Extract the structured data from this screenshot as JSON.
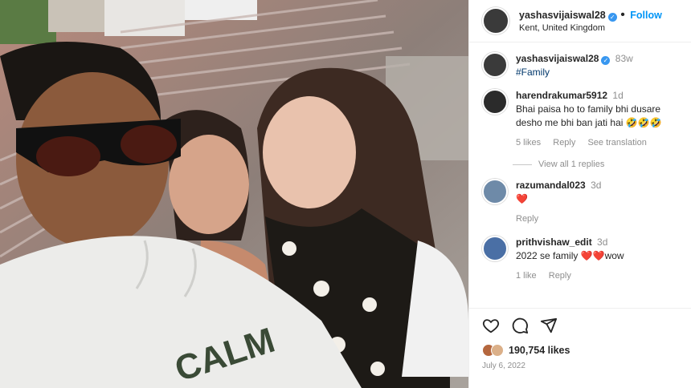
{
  "post": {
    "username": "yashasvijaiswal28",
    "follow_label": "Follow",
    "location": "Kent, United Kingdom",
    "caption_age": "83w",
    "caption": "#Family",
    "likes": "190,754 likes",
    "date": "July 6, 2022",
    "photo_text": "CALM"
  },
  "comments": [
    {
      "username": "harendrakumar5912",
      "age": "1d",
      "text": "Bhai paisa ho to family bhi dusare desho me bhi ban jati hai 🤣🤣🤣",
      "likes": "5 likes",
      "reply": "Reply",
      "translate": "See translation",
      "view_replies": "View all 1 replies"
    },
    {
      "username": "razumandal023",
      "age": "3d",
      "text": "❤️",
      "reply": "Reply"
    },
    {
      "username": "prithvishaw_edit",
      "age": "3d",
      "text": "2022 se family ❤️❤️wow",
      "likes": "1 like",
      "reply": "Reply"
    }
  ],
  "icons": [
    "heart-icon",
    "comment-icon",
    "share-icon"
  ],
  "colors": {
    "link": "#0095f6",
    "verified": "#3897f0",
    "hashtag": "#00376b",
    "heart": "#ed4956"
  }
}
